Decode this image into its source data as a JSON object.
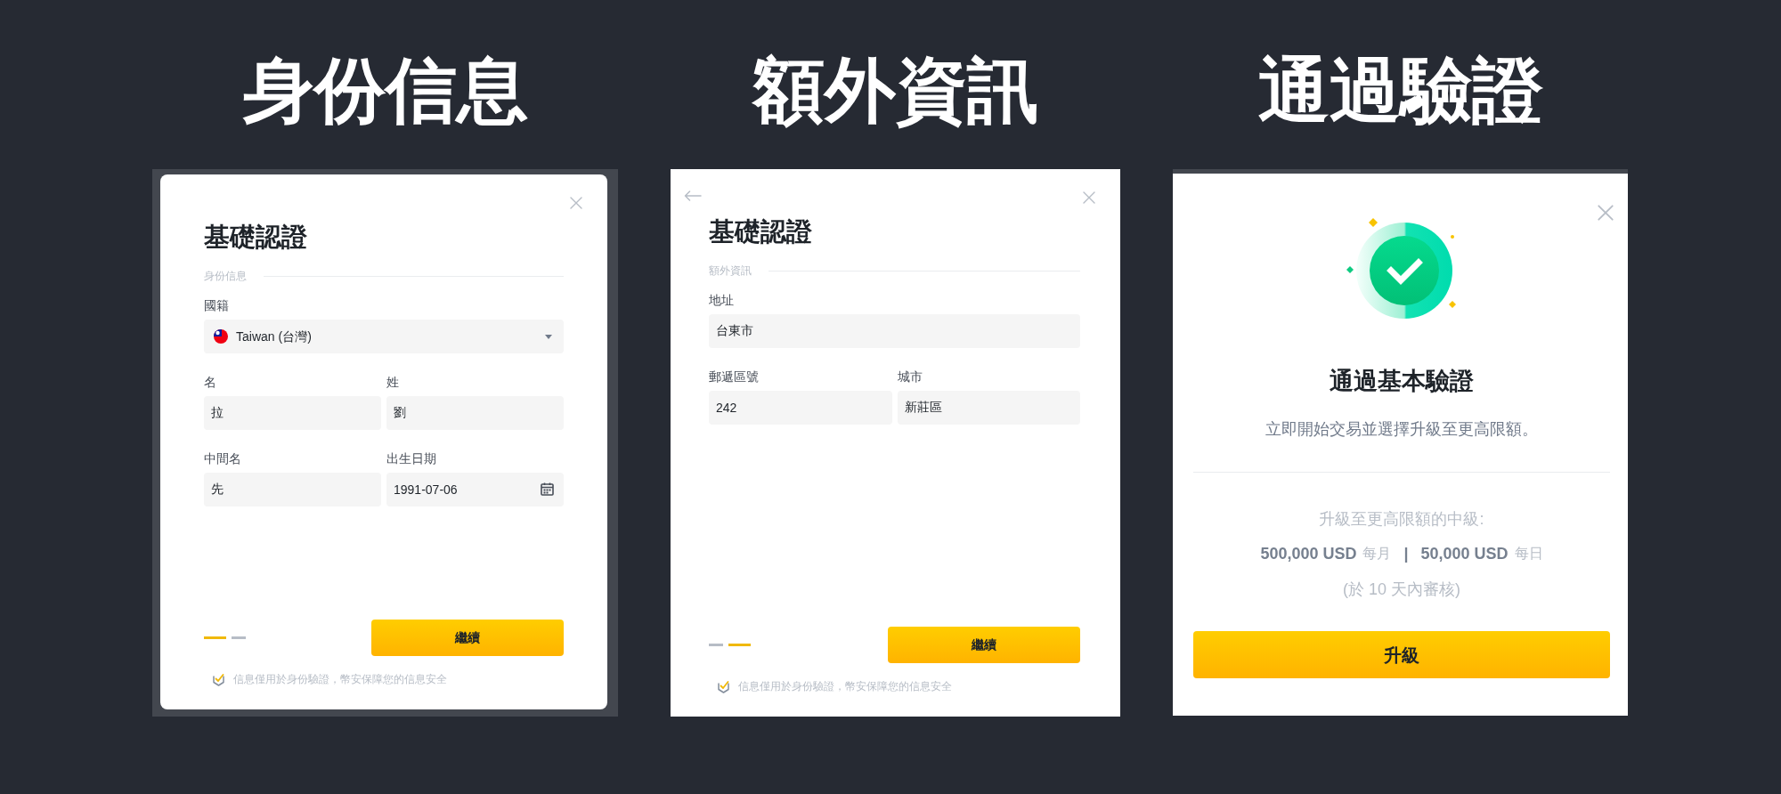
{
  "panels": [
    {
      "kind": "form",
      "heading": "身份信息",
      "framed": true,
      "top_strip": false,
      "back_button": false,
      "title": "基礎認證",
      "section": "身份信息",
      "rows": [
        {
          "fields": [
            {
              "kind": "select",
              "label": "國籍",
              "value": "Taiwan (台灣)"
            }
          ]
        },
        {
          "fields": [
            {
              "kind": "text",
              "label": "名",
              "value": "拉"
            },
            {
              "kind": "text",
              "label": "姓",
              "value": "劉"
            }
          ]
        },
        {
          "fields": [
            {
              "kind": "text",
              "label": "中間名",
              "value": "先"
            },
            {
              "kind": "date",
              "label": "出生日期",
              "value": "1991-07-06"
            }
          ]
        }
      ],
      "steps": [
        {
          "selected": true
        },
        {
          "selected": false
        }
      ],
      "button": "繼續",
      "note": "信息僅用於身份驗證，幣安保障您的信息安全"
    },
    {
      "kind": "form",
      "heading": "額外資訊",
      "framed": false,
      "top_strip": false,
      "back_button": true,
      "title": "基礎認證",
      "section": "額外資訊",
      "rows": [
        {
          "fields": [
            {
              "kind": "text",
              "label": "地址",
              "value": "台東市"
            }
          ]
        },
        {
          "fields": [
            {
              "kind": "text",
              "label": "郵遞區號",
              "value": "242"
            },
            {
              "kind": "text",
              "label": "城市",
              "value": "新莊區"
            }
          ]
        }
      ],
      "steps": [
        {
          "selected": false
        },
        {
          "selected": true
        }
      ],
      "button": "繼續",
      "note": "信息僅用於身份驗證，幣安保障您的信息安全"
    },
    {
      "kind": "success",
      "heading": "通過驗證",
      "framed": false,
      "top_strip": true,
      "title": "通過基本驗證",
      "subtitle": "立即開始交易並選擇升級至更高限額。",
      "upgrade_label": "升級至更高限額的中級:",
      "limits": [
        {
          "amount": "500,000 USD",
          "period": "每月"
        },
        {
          "amount": "50,000 USD",
          "period": "每日"
        }
      ],
      "separator": "|",
      "review_note": "(於 10 天內審核)",
      "button": "升級"
    }
  ]
}
